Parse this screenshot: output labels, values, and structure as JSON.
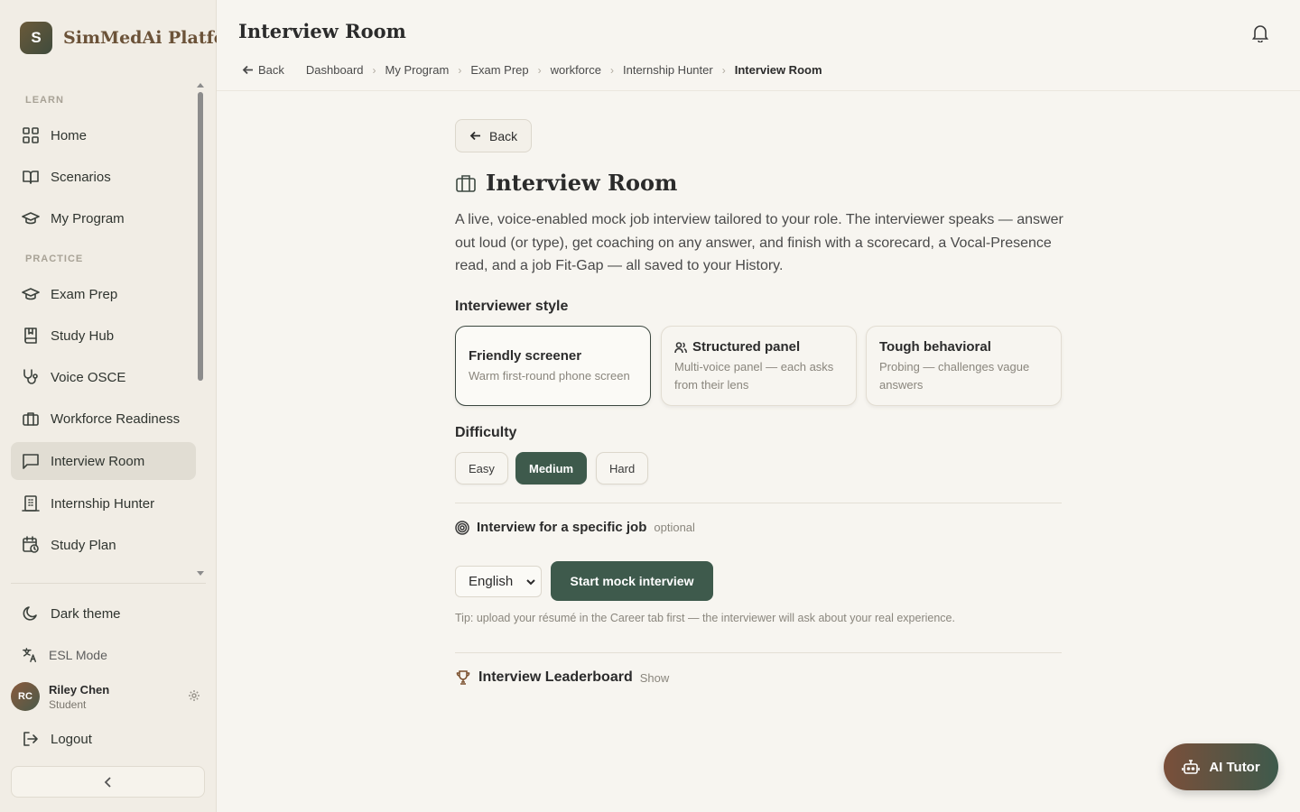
{
  "brand": {
    "logo_letter": "S",
    "name": "SimMedAi Platform"
  },
  "sidebar": {
    "learn_label": "LEARN",
    "practice_label": "PRACTICE",
    "items": [
      {
        "label": "Home",
        "icon": "grid-icon"
      },
      {
        "label": "Scenarios",
        "icon": "book-open-icon"
      },
      {
        "label": "My Program",
        "icon": "graduation-cap-icon"
      },
      {
        "label": "Exam Prep",
        "icon": "graduation-cap-icon"
      },
      {
        "label": "Study Hub",
        "icon": "bookmark-book-icon"
      },
      {
        "label": "Voice OSCE",
        "icon": "stethoscope-icon"
      },
      {
        "label": "Workforce Readiness",
        "icon": "briefcase-icon"
      },
      {
        "label": "Interview Room",
        "icon": "message-square-icon",
        "active": true
      },
      {
        "label": "Internship Hunter",
        "icon": "building-icon"
      },
      {
        "label": "Study Plan",
        "icon": "calendar-clock-icon"
      }
    ],
    "dark_theme": "Dark theme",
    "esl_mode": "ESL Mode",
    "user": {
      "initials": "RC",
      "name": "Riley Chen",
      "role": "Student"
    },
    "logout": "Logout"
  },
  "header": {
    "title": "Interview Room",
    "breadcrumb": {
      "back": "Back",
      "items": [
        "Dashboard",
        "My Program",
        "Exam Prep",
        "workforce",
        "Internship Hunter"
      ],
      "current": "Interview Room"
    }
  },
  "main": {
    "back_label": "Back",
    "title": "Interview Room",
    "description": "A live, voice-enabled mock job interview tailored to your role. The interviewer speaks — answer out loud (or type), get coaching on any answer, and finish with a scorecard, a Vocal-Presence read, and a job Fit-Gap — all saved to your History.",
    "style_label": "Interviewer style",
    "styles": [
      {
        "title": "Friendly screener",
        "subtitle": "Warm first-round phone screen",
        "selected": true
      },
      {
        "title": "Structured panel",
        "subtitle": "Multi-voice panel — each asks from their lens",
        "icon": "users-icon"
      },
      {
        "title": "Tough behavioral",
        "subtitle": "Probing — challenges vague answers"
      }
    ],
    "difficulty_label": "Difficulty",
    "difficulties": [
      "Easy",
      "Medium",
      "Hard"
    ],
    "difficulty_selected": "Medium",
    "job_label": "Interview for a specific job",
    "job_optional": "optional",
    "language": "English",
    "start_button": "Start mock interview",
    "tip": "Tip: upload your résumé in the Career tab first — the interviewer will ask about your real experience.",
    "leaderboard_label": "Interview Leaderboard",
    "leaderboard_toggle": "Show"
  },
  "ai_tutor": "AI Tutor",
  "colors": {
    "accent": "#3e5a4c",
    "brand_text": "#6b5238",
    "background": "#f7f5f0",
    "sidebar_bg": "#f1ede5"
  }
}
